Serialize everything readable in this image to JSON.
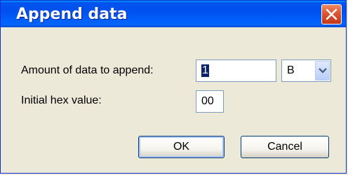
{
  "window": {
    "title": "Append data"
  },
  "form": {
    "amount_label": "Amount of data to append:",
    "amount_value": "1",
    "unit_selected": "B",
    "hex_label": "Initial hex value:",
    "hex_value": "00"
  },
  "buttons": {
    "ok": "OK",
    "cancel": "Cancel"
  },
  "colors": {
    "titlebar": "#0053ee",
    "dialog_bg": "#ece9d8",
    "close_button": "#dc5530",
    "selection": "#0a246a"
  },
  "icons": {
    "close": "close-icon",
    "dropdown": "chevron-down-icon"
  }
}
